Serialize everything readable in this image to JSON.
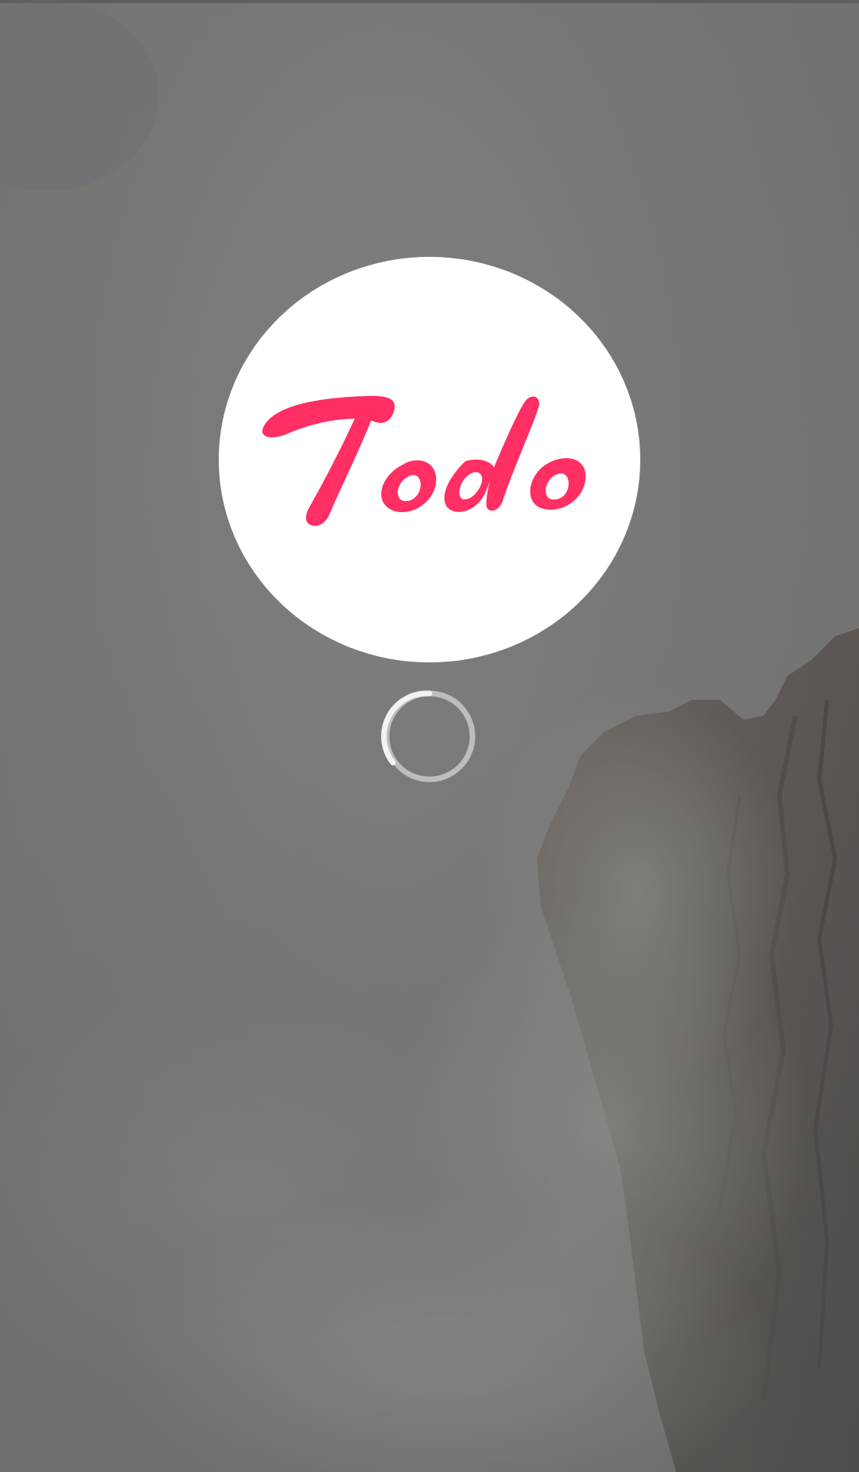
{
  "app": {
    "logo_text": "Todo",
    "brand_color": "#ff2e63",
    "logo_bg_color": "#ffffff"
  },
  "splash": {
    "background_description_icon": "misty-cliff-background",
    "loading_indicator": "spinner-icon"
  }
}
